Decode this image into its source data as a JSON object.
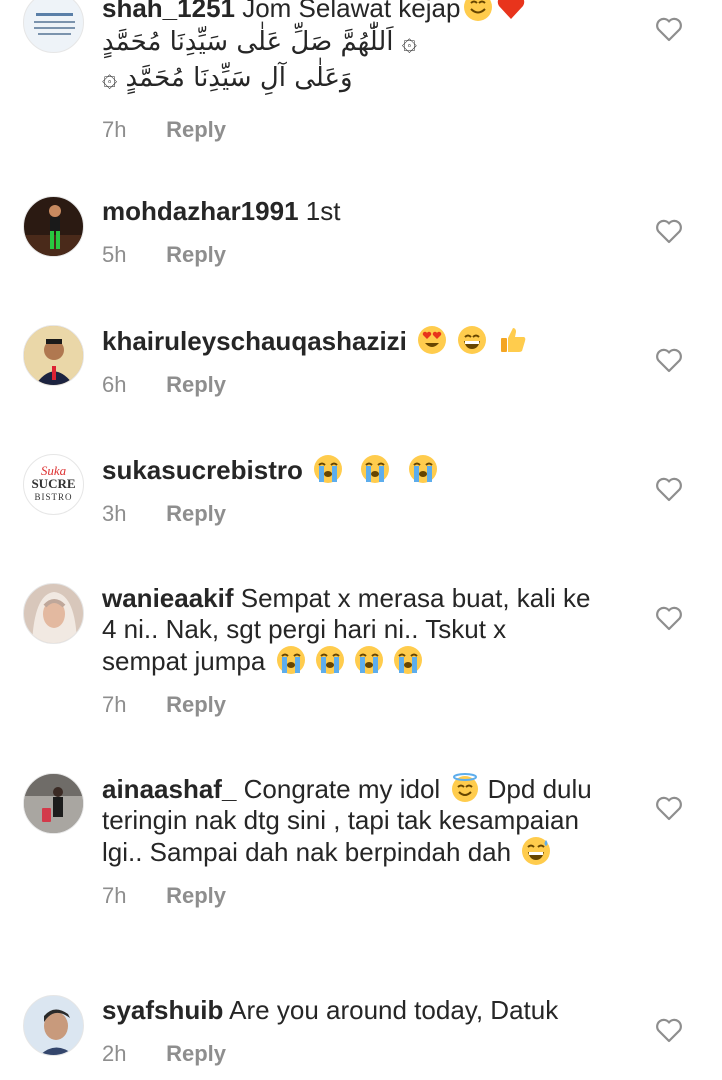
{
  "comments": [
    {
      "username": "shah_1251",
      "message": "Jom Selawat kejap",
      "line2": "۞ اَللّٰهُمَّ صَلِّ عَلٰى سَيِّدِنَا مُحَمَّدٍ",
      "line3": "وَعَلٰى آلِ سَيِّدِنَا مُحَمَّدٍ ۞",
      "time": "7h",
      "reply": "Reply",
      "emojis": [
        "smiling-face-emoji",
        "red-heart-emoji"
      ]
    },
    {
      "username": "mohdazhar1991",
      "message": "1st",
      "time": "5h",
      "reply": "Reply"
    },
    {
      "username": "khairuleyschauqashazizi",
      "message": "",
      "time": "6h",
      "reply": "Reply",
      "emojis": [
        "heart-eyes-emoji",
        "grinning-emoji",
        "thumbs-up-emoji"
      ]
    },
    {
      "username": "sukasucrebistro",
      "message": "",
      "time": "3h",
      "reply": "Reply",
      "emojis": [
        "loudly-crying-emoji",
        "loudly-crying-emoji",
        "loudly-crying-emoji"
      ],
      "avatar_text": [
        "Suka",
        "SUCRE",
        "BISTRO"
      ]
    },
    {
      "username": "wanieaakif",
      "message": "Sempat x merasa buat, kali ke 4 ni.. Nak, sgt pergi hari ni.. Tskut x sempat jumpa",
      "time": "7h",
      "reply": "Reply",
      "emojis": [
        "loudly-crying-emoji",
        "loudly-crying-emoji",
        "loudly-crying-emoji",
        "loudly-crying-emoji"
      ]
    },
    {
      "username": "ainaashaf_",
      "message_a": "Congrate my idol",
      "message_b": "Dpd dulu teringin nak dtg sini , tapi tak kesampaian lgi.. Sampai dah nak berpindah dah",
      "time": "7h",
      "reply": "Reply",
      "emojis": [
        "smiling-halo-emoji",
        "grinning-sweat-emoji"
      ]
    },
    {
      "username": "syafshuib",
      "message": "Are you around today, Datuk",
      "time": "2h",
      "reply": "Reply"
    }
  ],
  "colors": {
    "text": "#262626",
    "meta": "#8e8e8e",
    "heart_outline": "#8e8e8e",
    "emoji_yellow": "#ffcc4d",
    "tear_blue": "#5dadec",
    "heart_red": "#e8341c"
  }
}
